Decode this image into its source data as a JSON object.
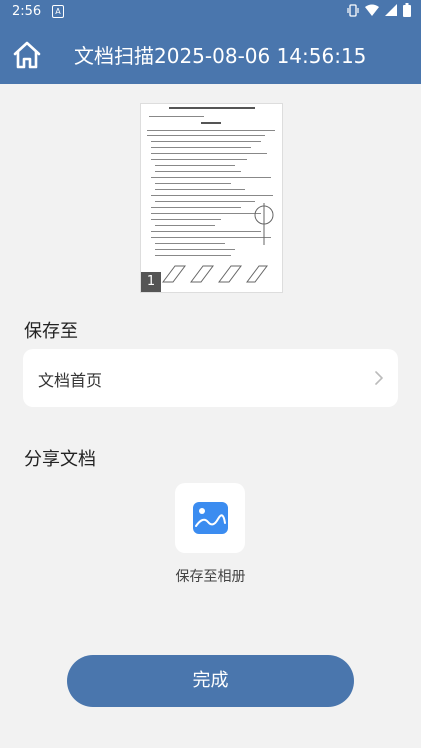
{
  "status_bar": {
    "time": "2:56",
    "notif_letter": "A"
  },
  "app_bar": {
    "title": "文档扫描2025-08-06 14:56:15"
  },
  "preview": {
    "page_number": "1"
  },
  "save_section": {
    "heading": "保存至",
    "location": "文档首页"
  },
  "share_section": {
    "heading": "分享文档",
    "option_label": "保存至相册"
  },
  "footer": {
    "done_label": "完成"
  },
  "colors": {
    "primary": "#4a76ad",
    "background": "#f2f2f2",
    "gallery_icon": "#3b8cf0"
  }
}
